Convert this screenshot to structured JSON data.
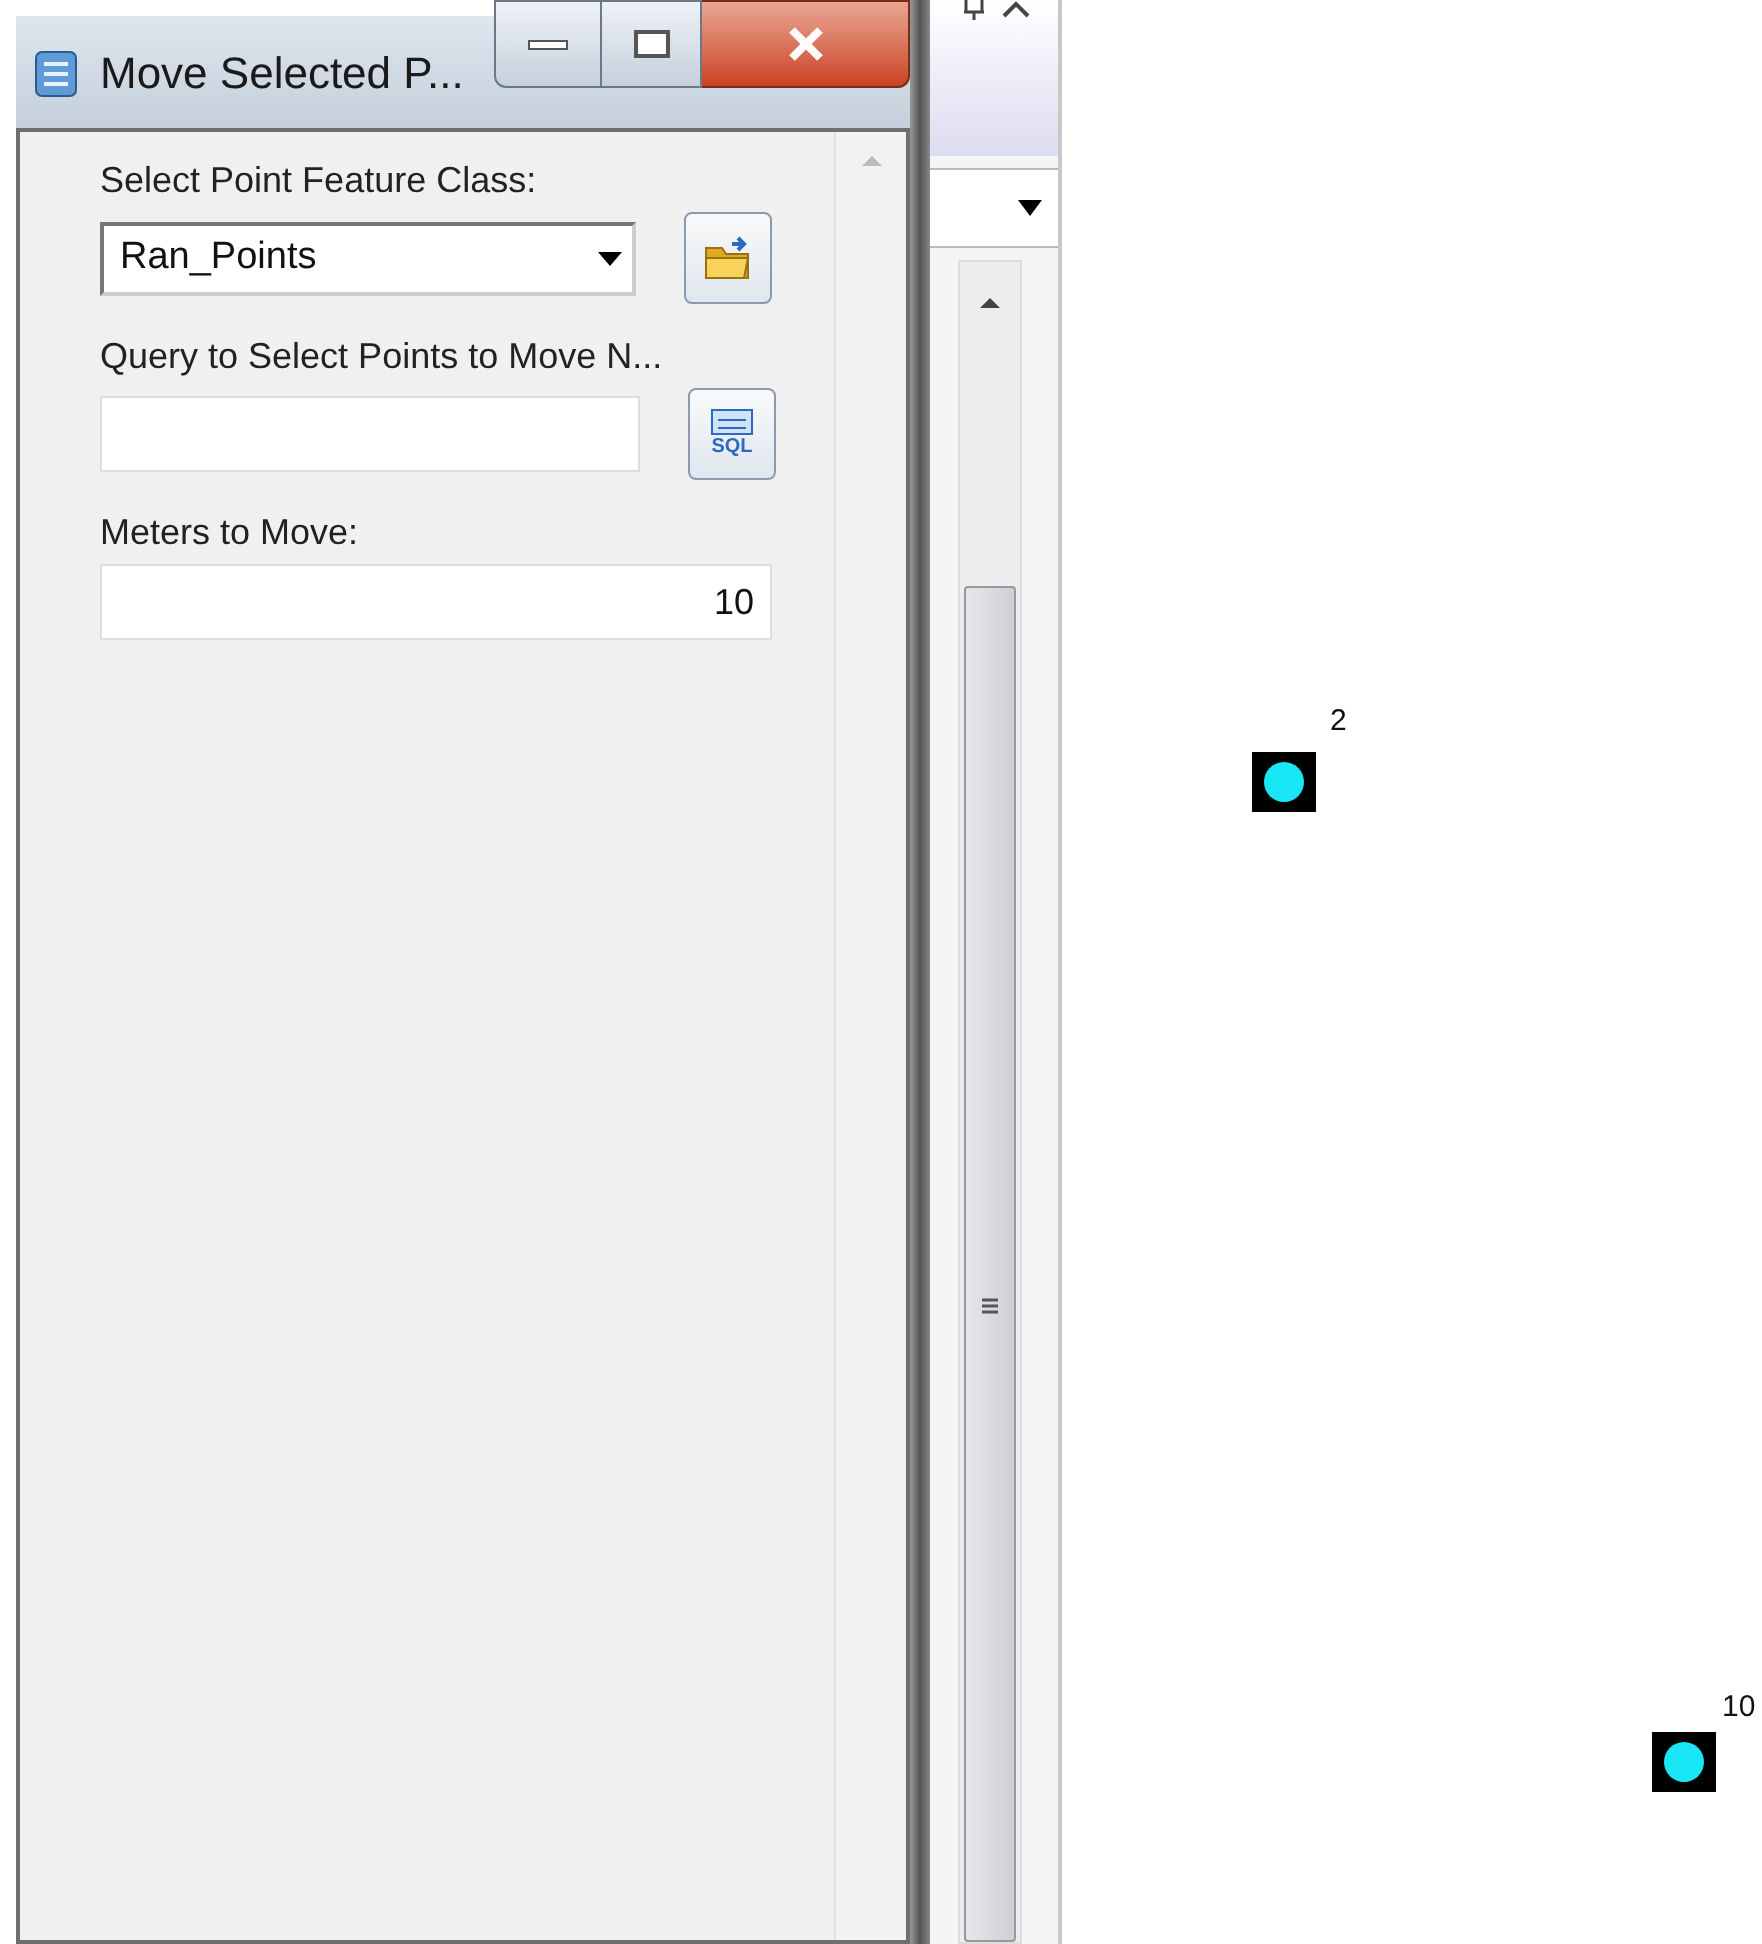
{
  "window": {
    "title": "Move Selected P..."
  },
  "form": {
    "fields": [
      {
        "kind": "dropdown",
        "label": "Select Point Feature Class:",
        "value": "Ran_Points",
        "button": {
          "kind": "folder"
        }
      },
      {
        "kind": "text",
        "label": "Query to Select Points to Move N...",
        "button": {
          "kind": "sql",
          "label": "SQL"
        }
      },
      {
        "kind": "number",
        "label": "Meters to Move:",
        "value": "10"
      }
    ]
  },
  "map": {
    "points": [
      {
        "label": "2"
      },
      {
        "label": "10"
      }
    ]
  }
}
